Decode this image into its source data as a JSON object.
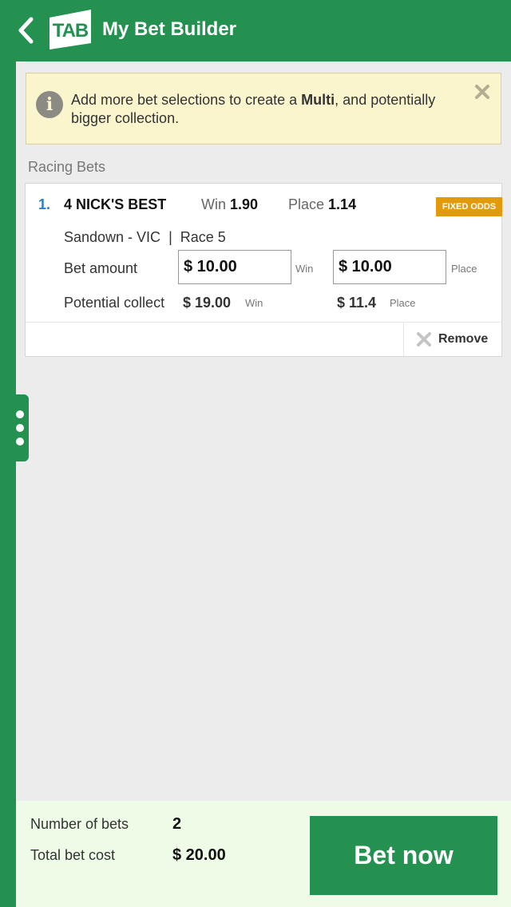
{
  "header": {
    "title": "My Bet Builder",
    "logo_text": "TAB",
    "brand_color": "#259151"
  },
  "info_banner": {
    "text_before": "Add more bet selections to create a ",
    "text_bold": "Multi",
    "text_after": ", and potentially bigger collection.",
    "icon": "info-icon",
    "close_icon": "close-icon"
  },
  "section": {
    "title": "Racing Bets"
  },
  "bet": {
    "number": "1.",
    "runner": "4 NICK'S BEST",
    "win_label": "Win",
    "win_odds": "1.90",
    "place_label": "Place",
    "place_odds": "1.14",
    "badge": "FIXED ODDS",
    "venue": "Sandown - VIC",
    "separator": "|",
    "race": "Race 5",
    "bet_amount_label": "Bet amount",
    "win_amount": "$ 10.00",
    "win_amount_label": "Win",
    "place_amount": "$ 10.00",
    "place_amount_label": "Place",
    "potential_label": "Potential collect",
    "potential_win": "$ 19.00",
    "potential_win_label": "Win",
    "potential_place": "$ 11.4",
    "potential_place_label": "Place",
    "remove_label": "Remove"
  },
  "footer": {
    "num_bets_label": "Number of bets",
    "num_bets": "2",
    "total_label": "Total bet cost",
    "total": "$ 20.00",
    "bet_now_label": "Bet now"
  }
}
